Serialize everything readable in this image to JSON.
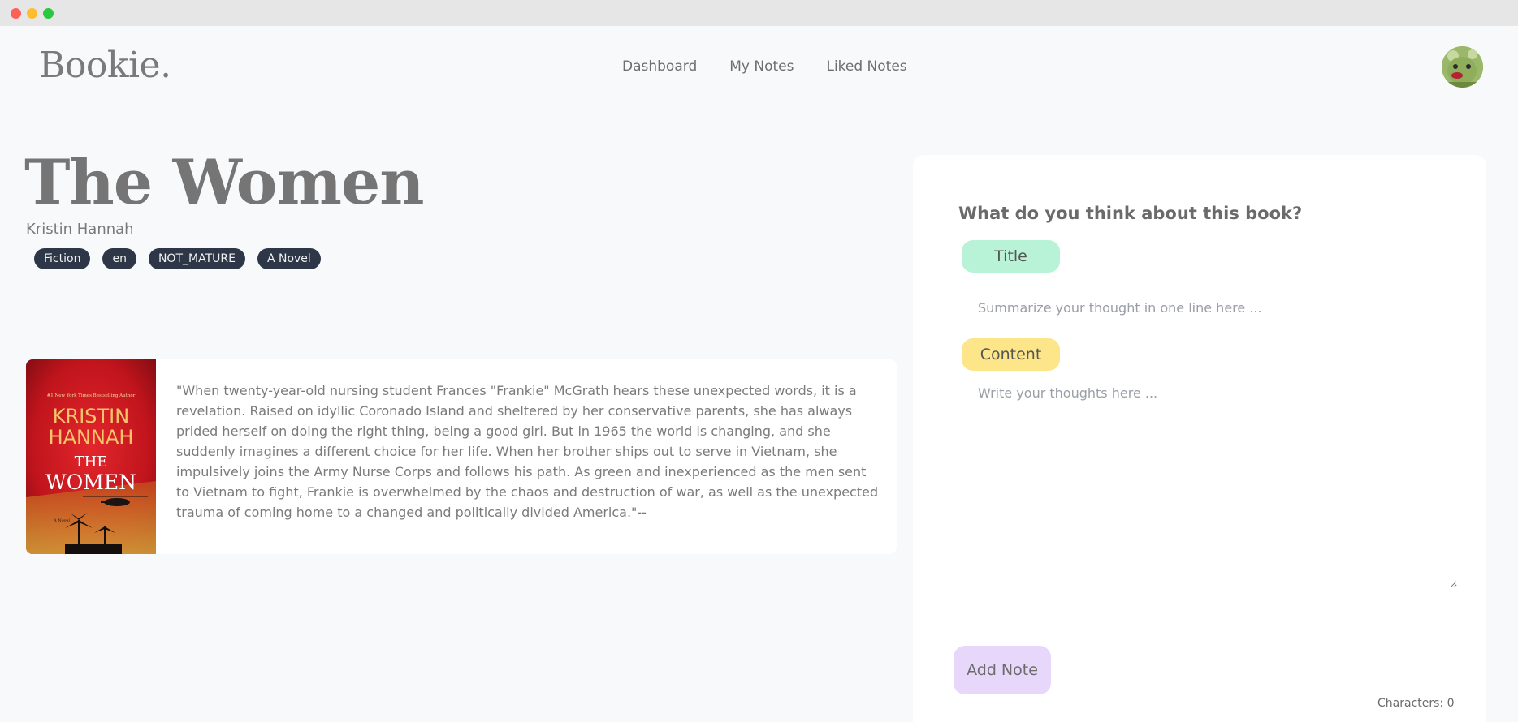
{
  "app": {
    "logo": "Bookie.",
    "nav": [
      "Dashboard",
      "My Notes",
      "Liked Notes"
    ]
  },
  "book": {
    "title": "The Women",
    "author": "Kristin Hannah",
    "tags": [
      "Fiction",
      "en",
      "NOT_MATURE",
      "A Novel"
    ],
    "description": "\"When twenty-year-old nursing student Frances \"Frankie\" McGrath hears these unexpected words, it is a revelation. Raised on idyllic Coronado Island and sheltered by her conservative parents, she has always prided herself on doing the right thing, being a good girl. But in 1965 the world is changing, and she suddenly imagines a different choice for her life. When her brother ships out to serve in Vietnam, she impulsively joins the Army Nurse Corps and follows his path. As green and inexperienced as the men sent to Vietnam to fight, Frankie is overwhelmed by the chaos and destruction of war, as well as the unexpected trauma of coming home to a changed and politically divided America.\"--",
    "cover": {
      "banner": "#1 New York Times Bestselling Author",
      "author_line1": "KRISTIN",
      "author_line2": "HANNAH",
      "title_line1": "THE",
      "title_line2": "WOMEN",
      "subtitle": "A Novel"
    }
  },
  "note_form": {
    "heading": "What do you think about this book?",
    "title_label": "Title",
    "title_placeholder": "Summarize your thought in one line here ...",
    "title_value": "",
    "content_label": "Content",
    "content_placeholder": "Write your thoughts here ...",
    "content_value": "",
    "submit_label": "Add Note",
    "char_count": "Characters: 0"
  },
  "colors": {
    "tag_bg": "#2d3748",
    "title_pill": "#b9f3d7",
    "content_pill": "#fde58a",
    "add_button": "#e7d7fb"
  }
}
